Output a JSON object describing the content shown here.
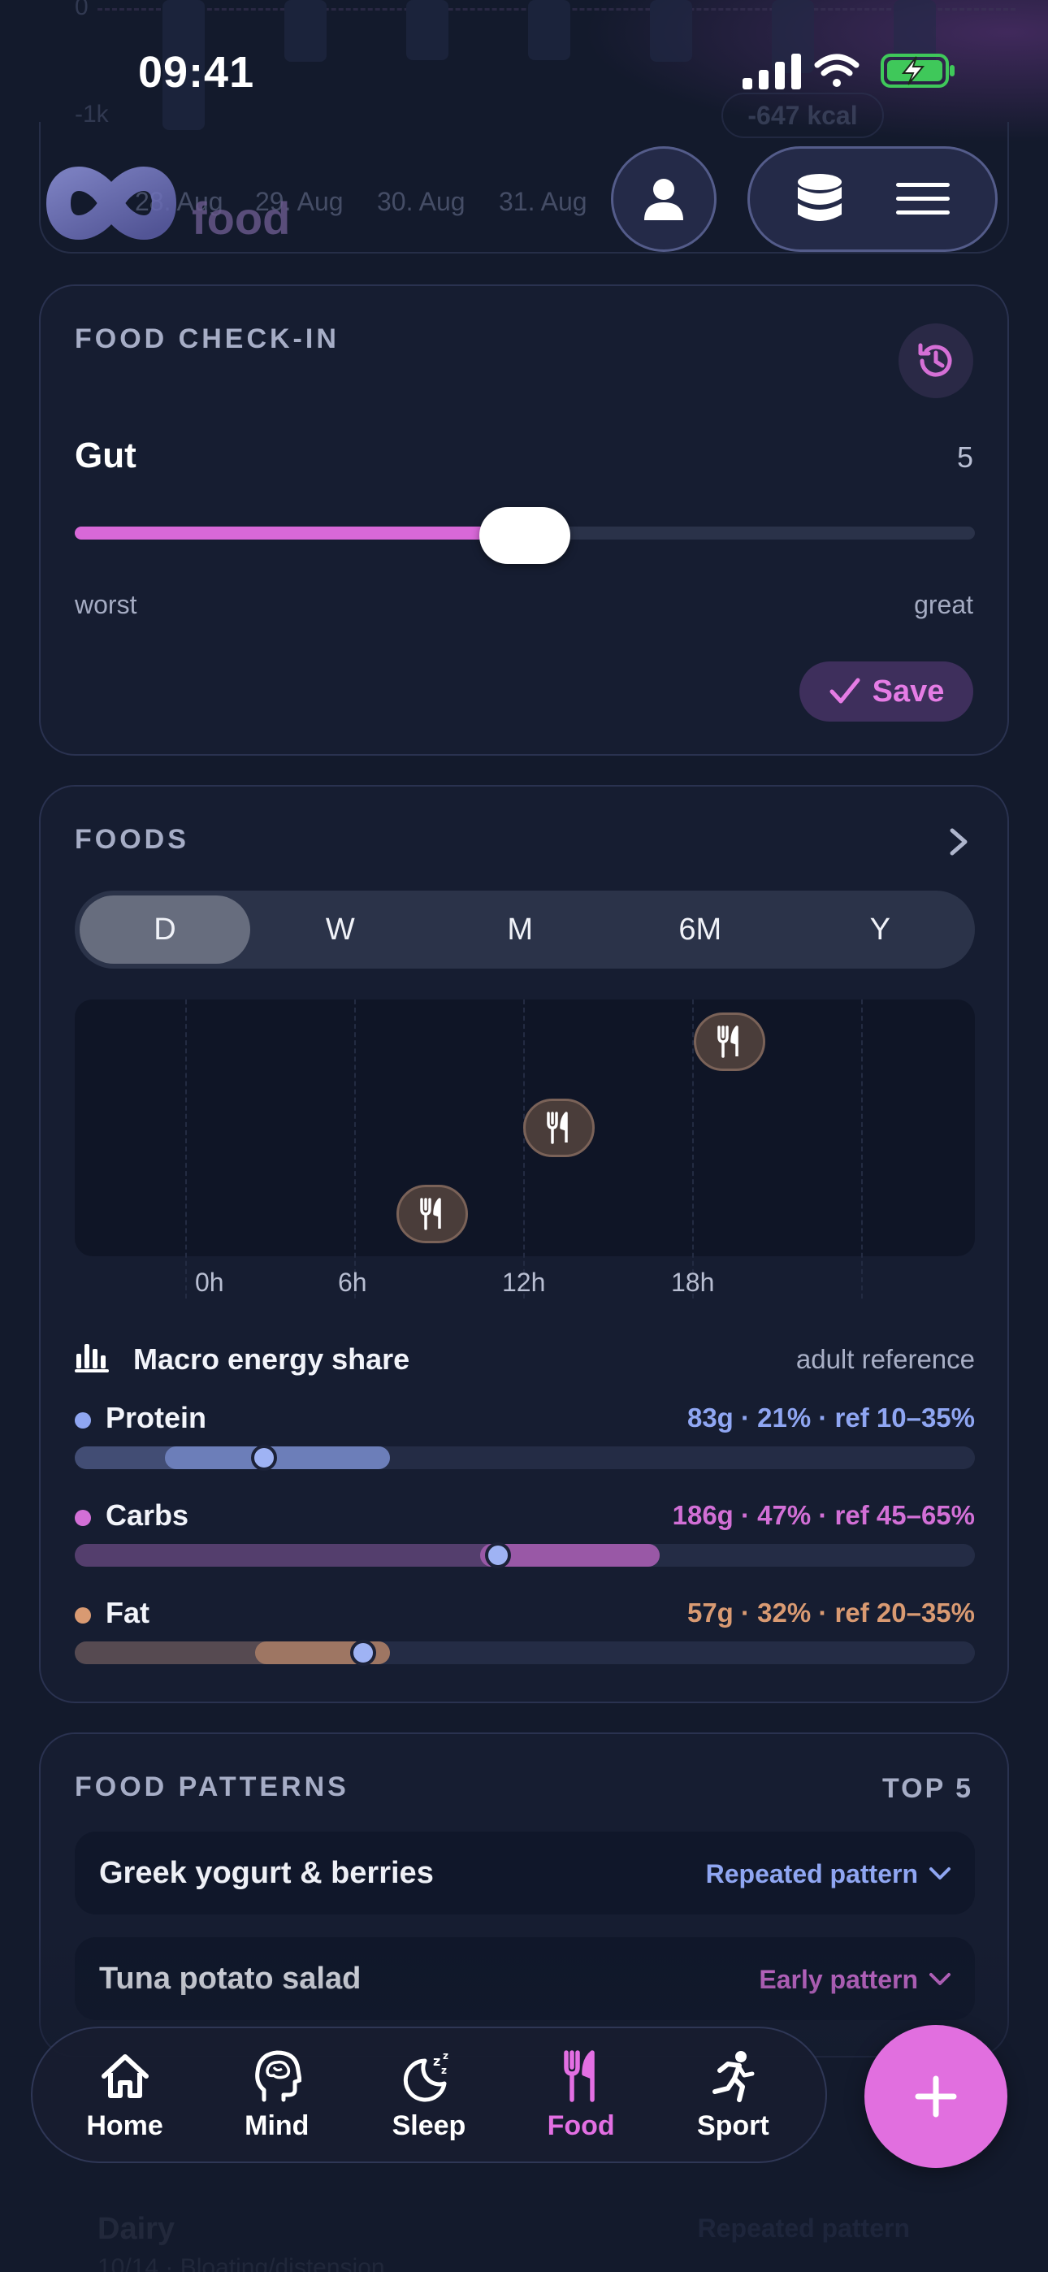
{
  "background_chart": {
    "y_ticks": [
      "0",
      "-1k"
    ],
    "dates": [
      "28. Aug",
      "29. Aug",
      "30. Aug",
      "31. Aug"
    ],
    "kcal_badge": "-647 kcal"
  },
  "status_bar": {
    "time": "09:41"
  },
  "header": {
    "logo_text": "food"
  },
  "checkin": {
    "title": "FOOD CHECK-IN",
    "metric_label": "Gut",
    "metric_value": "5",
    "slider_fraction": 0.5,
    "range_min_label": "worst",
    "range_max_label": "great",
    "save_label": "Save"
  },
  "foods": {
    "title": "FOODS",
    "segments": [
      "D",
      "W",
      "M",
      "6M",
      "Y"
    ],
    "active_segment": "D",
    "x_ticks": [
      "0h",
      "6h",
      "12h",
      "18h"
    ],
    "macro_title": "Macro energy share",
    "macro_reference": "adult reference",
    "macros": [
      {
        "name": "Protein",
        "value_text": "83g · 21% · ref 10–35%",
        "color": "#8fa6f2",
        "share": 0.21,
        "ref_min": 0.1,
        "ref_max": 0.35
      },
      {
        "name": "Carbs",
        "value_text": "186g · 47% · ref 45–65%",
        "color": "#d26fd6",
        "share": 0.47,
        "ref_min": 0.45,
        "ref_max": 0.65
      },
      {
        "name": "Fat",
        "value_text": "57g · 32% · ref 20–35%",
        "color": "#d99a72",
        "share": 0.32,
        "ref_min": 0.2,
        "ref_max": 0.35
      }
    ]
  },
  "patterns": {
    "title": "FOOD PATTERNS",
    "badge": "TOP 5",
    "items": [
      {
        "name": "Greek yogurt & berries",
        "tag": "Repeated pattern",
        "tag_color": "#8fa6f2"
      },
      {
        "name": "Tuna potato salad",
        "tag": "Early pattern",
        "tag_color": "#d26fd6"
      }
    ],
    "faded_item": {
      "name": "Dairy",
      "sub": "10/14 · Bloating/distension",
      "tag": "Repeated pattern"
    }
  },
  "nav": {
    "tabs": [
      {
        "label": "Home",
        "icon": "home-icon"
      },
      {
        "label": "Mind",
        "icon": "brain-icon"
      },
      {
        "label": "Sleep",
        "icon": "moon-icon"
      },
      {
        "label": "Food",
        "icon": "fork-knife-icon"
      },
      {
        "label": "Sport",
        "icon": "runner-icon"
      }
    ],
    "active": "Food",
    "fab_icon": "plus-icon"
  },
  "colors": {
    "accent": "#e16fdf",
    "protein": "#8fa6f2",
    "carbs": "#d26fd6",
    "fat": "#d99a72",
    "card_bg": "#161d31",
    "page_bg": "#131a2c"
  }
}
